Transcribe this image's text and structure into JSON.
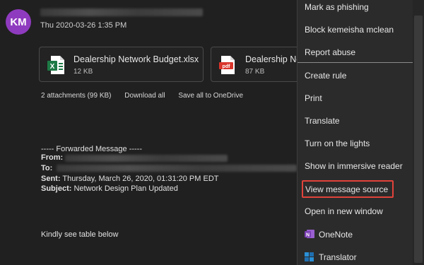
{
  "message": {
    "avatar_initials": "KM",
    "date": "Thu 2020-03-26 1:35 PM"
  },
  "attachments": [
    {
      "name": "Dealership Network Budget.xlsx",
      "size": "12 KB",
      "icon": "excel-icon"
    },
    {
      "name": "Dealership Ne",
      "size": "87 KB",
      "icon": "pdf-icon"
    }
  ],
  "attachment_bar": {
    "summary": "2 attachments (99 KB)",
    "download_all": "Download all",
    "save_onedrive": "Save all to OneDrive"
  },
  "forwarded": {
    "header": "----- Forwarded Message -----",
    "from_label": "From:",
    "to_label": "To:",
    "sent_label": "Sent:",
    "sent_value": "Thursday, March 26, 2020, 01:31:20 PM EDT",
    "subject_label": "Subject:",
    "subject_value": "Network Design Plan Updated",
    "body": "Kindly see table below"
  },
  "menu": {
    "items": [
      {
        "label": "Mark as phishing"
      },
      {
        "label": "Block kemeisha mclean"
      },
      {
        "label": "Report abuse"
      },
      {
        "label": "Create rule"
      },
      {
        "label": "Print"
      },
      {
        "label": "Translate"
      },
      {
        "label": "Turn on the lights"
      },
      {
        "label": "Show in immersive reader"
      },
      {
        "label": "View message source",
        "highlighted": true
      },
      {
        "label": "Open in new window"
      },
      {
        "label": "OneNote",
        "icon": "onenote-icon"
      },
      {
        "label": "Translator",
        "icon": "translator-icon"
      }
    ]
  },
  "colors": {
    "background": "#202020",
    "menu_background": "#2b2b2b",
    "avatar": "#8f3bbf",
    "highlight_border": "#e0433a",
    "excel_green": "#1d7a45",
    "pdf_red": "#d9352b",
    "onenote_purple": "#7b3fb5"
  }
}
